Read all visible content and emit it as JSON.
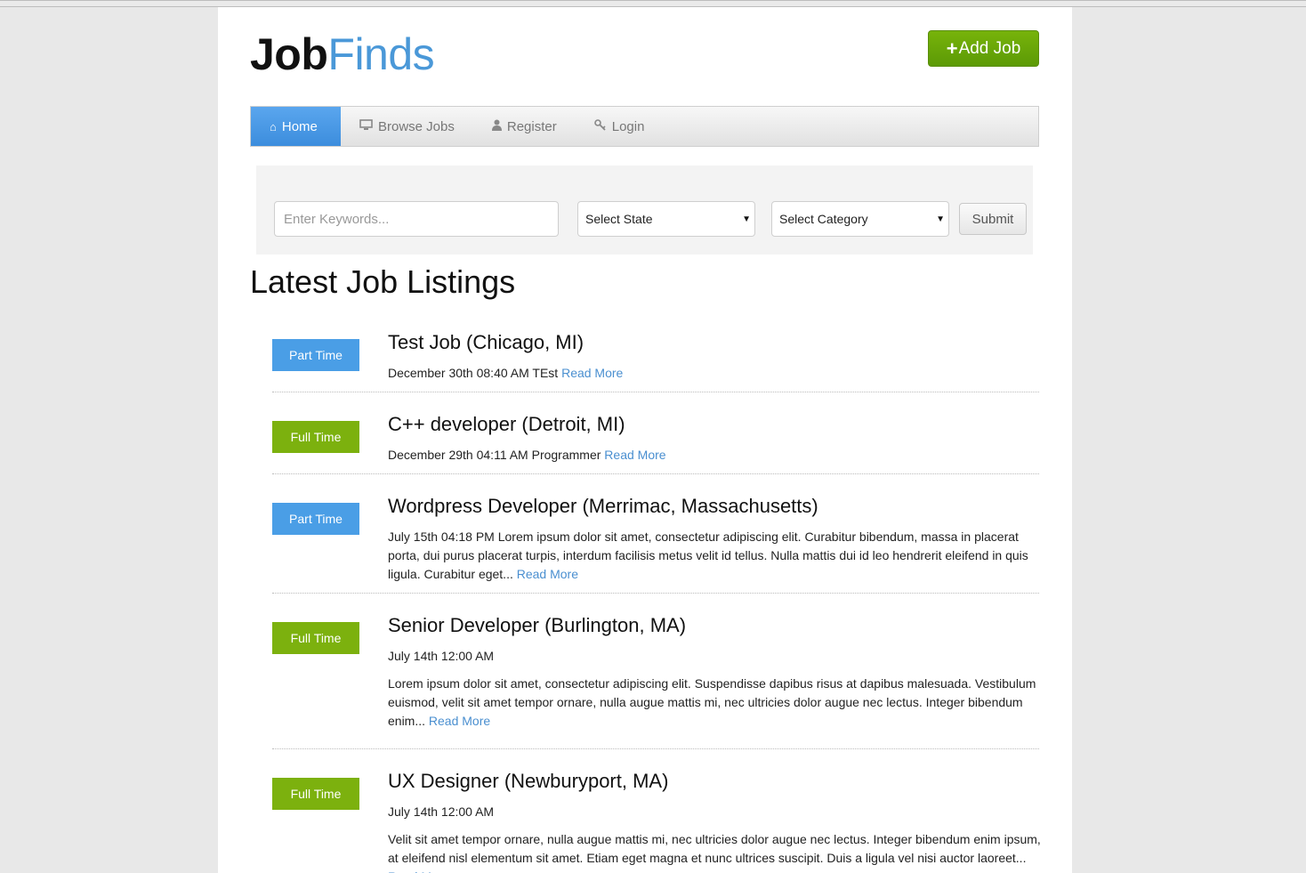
{
  "brand": {
    "part1": "Job",
    "part2": "Finds"
  },
  "add_job": {
    "plus": "+",
    "label": "Add Job"
  },
  "nav": {
    "home": "Home",
    "browse": "Browse Jobs",
    "register": "Register",
    "login": "Login"
  },
  "search": {
    "keywords_placeholder": "Enter Keywords...",
    "state": "Select State",
    "category": "Select Category",
    "submit": "Submit"
  },
  "listings_heading": "Latest Job Listings",
  "read_more": "Read More",
  "jobs": [
    {
      "type": "Part Time",
      "title": "Test Job (Chicago, MI)",
      "meta": "December 30th 08:40 AM TEst"
    },
    {
      "type": "Full Time",
      "title": "C++ developer (Detroit, MI)",
      "meta": "December 29th 04:11 AM Programmer"
    },
    {
      "type": "Part Time",
      "title": "Wordpress Developer (Merrimac, Massachusetts)",
      "meta": "July 15th 04:18 PM Lorem ipsum dolor sit amet, consectetur adipiscing elit. Curabitur bibendum, massa in placerat porta, dui purus placerat turpis, interdum facilisis metus velit id tellus. Nulla mattis dui id leo hendrerit eleifend in quis ligula. Curabitur eget..."
    },
    {
      "type": "Full Time",
      "title": "Senior Developer (Burlington, MA)",
      "meta": "July 14th 12:00 AM",
      "desc": "Lorem ipsum dolor sit amet, consectetur adipiscing elit. Suspendisse dapibus risus at dapibus malesuada. Vestibulum euismod, velit sit amet tempor ornare, nulla augue mattis mi, nec ultricies dolor augue nec lectus. Integer bibendum enim..."
    },
    {
      "type": "Full Time",
      "title": "UX Designer (Newburyport, MA)",
      "meta": "July 14th 12:00 AM",
      "desc": "Velit sit amet tempor ornare, nulla augue mattis mi, nec ultricies dolor augue nec lectus. Integer bibendum enim ipsum, at eleifend nisl elementum sit amet. Etiam eget magna et nunc ultrices suscipit. Duis a ligula vel nisi auctor laoreet..."
    }
  ],
  "colors": {
    "brand_blue": "#4a98d8",
    "part_time": "#4a9ee6",
    "full_time": "#7cb10e",
    "add_job": "#6aa80a"
  },
  "icons": {
    "home": "home-icon",
    "browse": "monitor-icon",
    "register": "user-icon",
    "login": "key-icon"
  }
}
